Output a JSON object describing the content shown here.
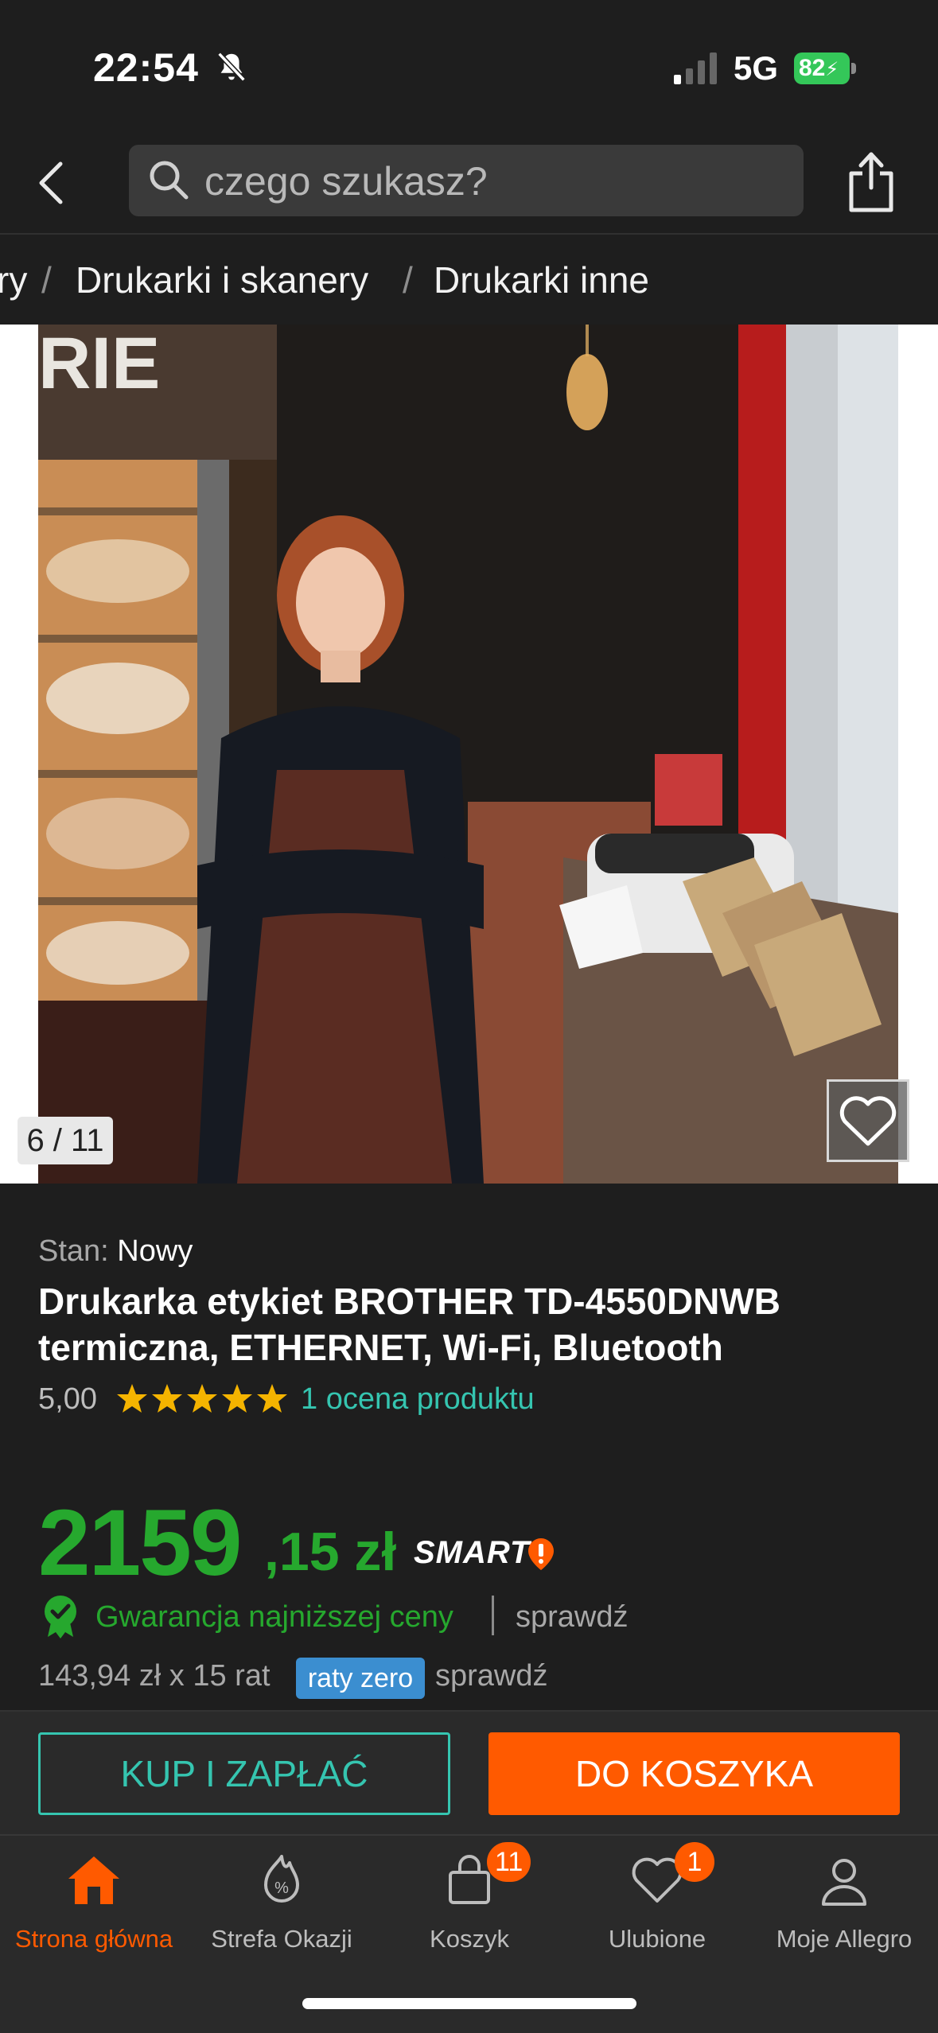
{
  "status_bar": {
    "time": "22:54",
    "network": "5G",
    "battery": "82"
  },
  "search": {
    "placeholder": "czego szukasz?"
  },
  "breadcrumb": {
    "items": [
      "ry",
      "Drukarki i skanery",
      "Drukarki inne"
    ],
    "separator": "/"
  },
  "gallery": {
    "counter": "6 / 11"
  },
  "product": {
    "condition_label": "Stan:",
    "condition_value": "Nowy",
    "title": "Drukarka etykiet BROTHER TD-4550DNWB termiczna, ETHERNET, Wi-Fi, Bluetooth",
    "rating_value": "5,00",
    "rating_stars": 5,
    "rating_link": "1 ocena produktu"
  },
  "price": {
    "main": "2159",
    "fraction": ",15 zł",
    "smart_label": "SMART",
    "guarantee_text": "Gwarancja najniższej ceny",
    "guarantee_check": "sprawdź",
    "installments_text": "143,94 zł x 15 rat",
    "installments_badge": "raty zero",
    "installments_check": "sprawdź"
  },
  "actions": {
    "buy_now": "KUP I ZAPŁAĆ",
    "add_to_cart": "DO KOSZYKA"
  },
  "bottom_nav": {
    "items": [
      {
        "label": "Strona główna",
        "icon": "home-icon",
        "active": true
      },
      {
        "label": "Strefa Okazji",
        "icon": "deals-icon",
        "active": false
      },
      {
        "label": "Koszyk",
        "icon": "cart-icon",
        "badge": "11",
        "active": false
      },
      {
        "label": "Ulubione",
        "icon": "heart-icon",
        "badge": "1",
        "active": false
      },
      {
        "label": "Moje Allegro",
        "icon": "user-icon",
        "active": false
      }
    ]
  },
  "colors": {
    "accent_orange": "#ff5a00",
    "price_green": "#26a82e",
    "link_teal": "#35c5b0",
    "background": "#1e1e1e"
  }
}
